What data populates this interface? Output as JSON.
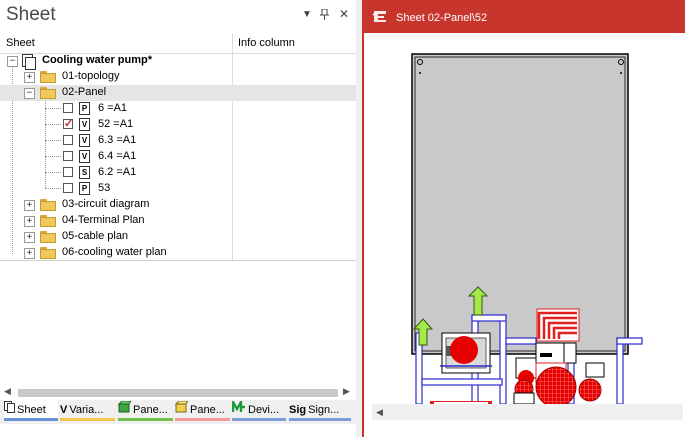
{
  "left_panel": {
    "title": "Sheet",
    "buttons": {
      "dropdown": "▼",
      "pin": "📌",
      "close": "✕"
    },
    "columns": {
      "sheet": "Sheet",
      "info": "Info column"
    },
    "tree": {
      "root": {
        "label": "Cooling water pump*",
        "expander": "−"
      },
      "folders": [
        {
          "label": "01-topology",
          "expander": "+"
        },
        {
          "label": "02-Panel",
          "expander": "−"
        },
        {
          "label": "03-circuit diagram",
          "expander": "+"
        },
        {
          "label": "04-Terminal Plan",
          "expander": "+"
        },
        {
          "label": "05-cable plan",
          "expander": "+"
        },
        {
          "label": "06-cooling water plan",
          "expander": "+"
        }
      ],
      "sheets": [
        {
          "label": "6 =A1",
          "icon": "P",
          "checked": false
        },
        {
          "label": "52 =A1",
          "icon": "V",
          "checked": true
        },
        {
          "label": "6.3 =A1",
          "icon": "V",
          "checked": false
        },
        {
          "label": "6.4 =A1",
          "icon": "V",
          "checked": false
        },
        {
          "label": "6.2 =A1",
          "icon": "S",
          "checked": false
        },
        {
          "label": "53",
          "icon": "P",
          "checked": false
        }
      ]
    },
    "scroll": {
      "left": "◀",
      "right": "▶"
    },
    "tabs": [
      {
        "label": "Sheet",
        "icon": "sheet-icon",
        "color": "#6b8fd6"
      },
      {
        "label": "Varia...",
        "icon": "V",
        "color": "#f2c94c"
      },
      {
        "label": "Pane...",
        "icon": "panel-green-icon",
        "color": "#6fbf4a"
      },
      {
        "label": "Pane...",
        "icon": "panel-yellow-icon",
        "color": "#f29a9a"
      },
      {
        "label": "Devi...",
        "icon": "device-icon",
        "color": "#7a9fd9"
      },
      {
        "label": "Sign...",
        "icon": "Sig",
        "color": "#7a9fd9"
      }
    ]
  },
  "right_panel": {
    "title": "Sheet 02-Panel\\52",
    "accent": "#c8352d",
    "scroll_left": "◀"
  }
}
